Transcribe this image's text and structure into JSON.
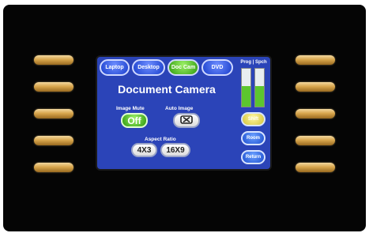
{
  "source_tabs": [
    {
      "label": "Laptop",
      "active": false
    },
    {
      "label": "Desktop",
      "active": false
    },
    {
      "label": "Doc Cam",
      "active": true
    },
    {
      "label": "DVD",
      "active": false
    }
  ],
  "meters": {
    "label": "Prog | Spch",
    "levels": [
      0.55,
      0.55
    ]
  },
  "title": "Document Camera",
  "image_mute": {
    "label": "Image Mute",
    "value": "Off"
  },
  "auto_image": {
    "label": "Auto Image",
    "icon": "x-box-icon"
  },
  "aspect_ratio": {
    "label": "Aspect Ratio",
    "options": [
      "4X3",
      "16X9"
    ]
  },
  "side_buttons": [
    "Shift",
    "Room",
    "Return"
  ],
  "colors": {
    "screen_bg": "#2b44b8",
    "active_green": "#5cc62e",
    "hardware_button": "#d9a74e"
  }
}
